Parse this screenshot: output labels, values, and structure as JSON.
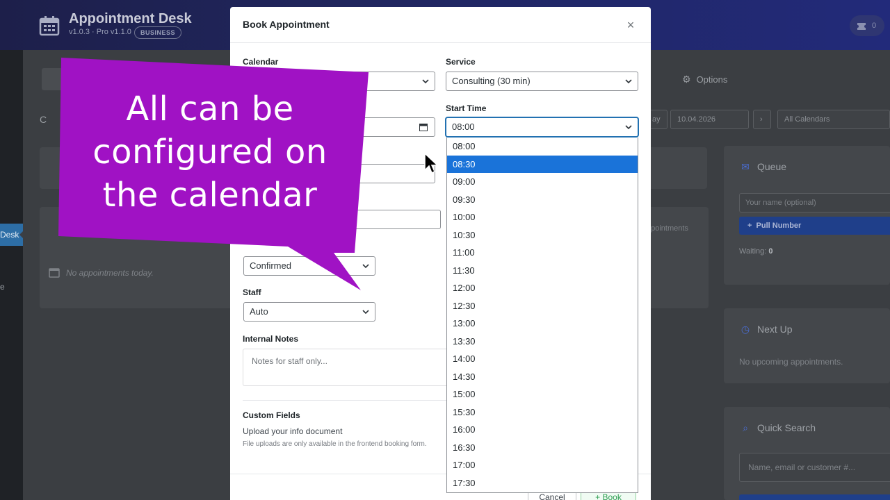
{
  "app": {
    "title": "Appointment Desk",
    "version": "v1.0.3 · Pro v1.1.0",
    "badge": "BUSINESS",
    "user_count": "0"
  },
  "sidebar": {
    "active_label": "Desk",
    "other_label": "e"
  },
  "background": {
    "options_label": "Options",
    "day_label": "ay",
    "date_value": "10.04.2026",
    "next_label": "›",
    "calendar_filter": "All Calendars",
    "gauge_label": "C",
    "no_appointments": "No appointments today.",
    "appointments_label": "ppointments",
    "queue": {
      "title": "Queue",
      "name_placeholder": "Your name (optional)",
      "pull_button": "Pull Number",
      "waiting_label": "Waiting:",
      "waiting_count": "0"
    },
    "next_up": {
      "title": "Next Up",
      "empty": "No upcoming appointments."
    },
    "quick_search": {
      "title": "Quick Search",
      "placeholder": "Name, email or customer #..."
    }
  },
  "modal": {
    "title": "Book Appointment",
    "close": "×",
    "calendar_label": "Calendar",
    "service_label": "Service",
    "service_value": "Consulting (30 min)",
    "start_time_label": "Start Time",
    "start_time_value": "08:00",
    "status_value": "Confirmed",
    "staff_label": "Staff",
    "staff_value": "Auto",
    "notes_label": "Internal Notes",
    "notes_placeholder": "Notes for staff only...",
    "custom_fields_title": "Custom Fields",
    "upload_label": "Upload your info document",
    "upload_note": "File uploads are only available in the frontend booking form.",
    "cancel_label": "Cancel",
    "book_label": "Book"
  },
  "time_options": [
    "08:00",
    "08:30",
    "09:00",
    "09:30",
    "10:00",
    "10:30",
    "11:00",
    "11:30",
    "12:00",
    "12:30",
    "13:00",
    "13:30",
    "14:00",
    "14:30",
    "15:00",
    "15:30",
    "16:00",
    "16:30",
    "17:00",
    "17:30"
  ],
  "highlighted_time": "08:30",
  "callout": {
    "line1": "All can be",
    "line2": "configured on",
    "line3": "the calendar",
    "color": "#a012c4"
  },
  "colors": {
    "accent": "#1a73d9",
    "brand": "#222a7a"
  }
}
